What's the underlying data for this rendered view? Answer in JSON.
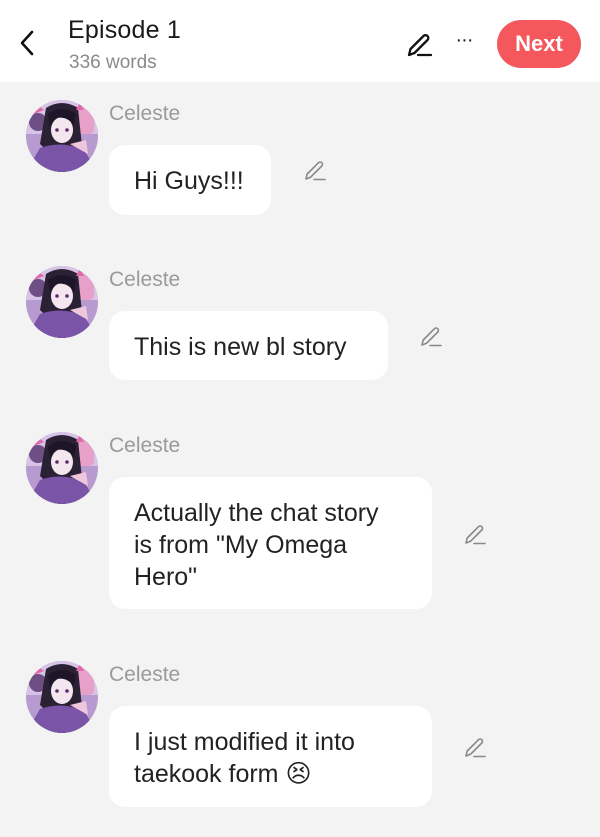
{
  "header": {
    "back_icon": "chevron-left-icon",
    "title": "Episode 1",
    "word_count": "336 words",
    "edit_icon": "pencil-icon",
    "more_icon": "more-horizontal-icon",
    "more_glyph": "···",
    "next_label": "Next"
  },
  "colors": {
    "accent": "#f4575c",
    "background": "#f3f3f3",
    "bubble": "#ffffff",
    "sender_text": "#9a9a9a"
  },
  "messages": [
    {
      "sender": "Celeste",
      "text": "Hi Guys!!!"
    },
    {
      "sender": "Celeste",
      "text": "This is new bl story"
    },
    {
      "sender": "Celeste",
      "text": "Actually the chat story\nis from \"My Omega\nHero\""
    },
    {
      "sender": "Celeste",
      "text": "I just modified it into\ntaekook form 😣"
    }
  ]
}
